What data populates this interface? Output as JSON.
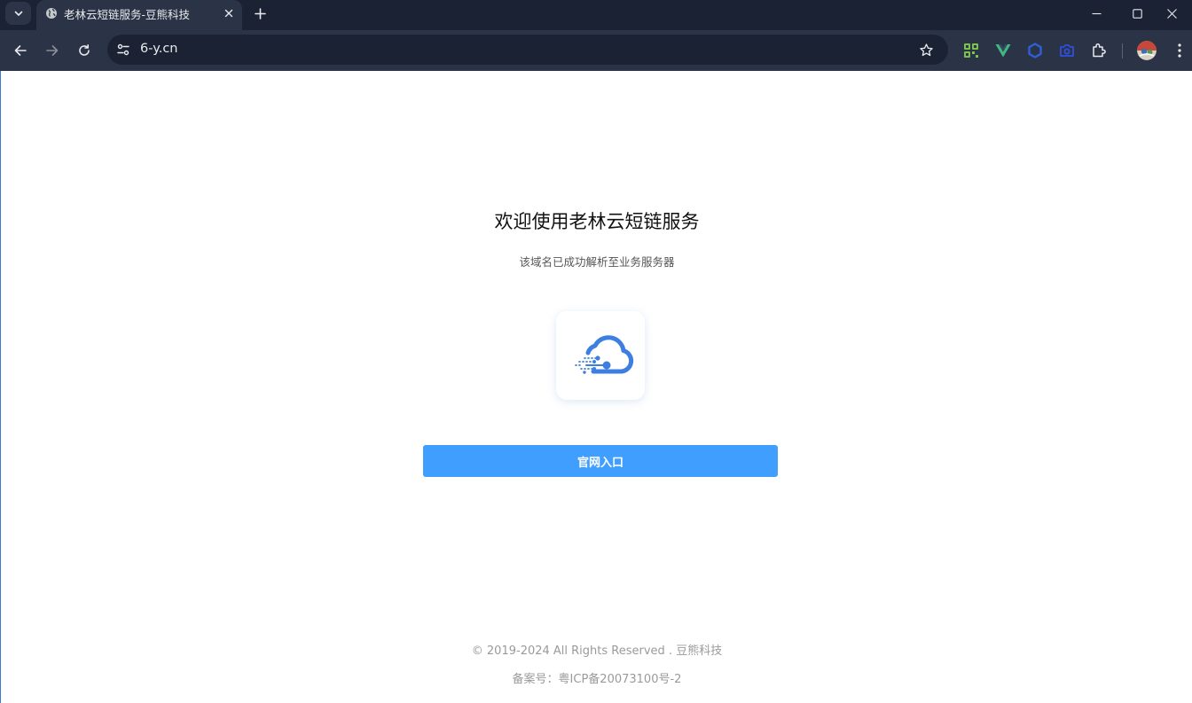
{
  "browser": {
    "tab_title": "老林云短链服务-豆熊科技",
    "url": "6-y.cn"
  },
  "page": {
    "heading": "欢迎使用老林云短链服务",
    "subheading": "该域名已成功解析至业务服务器",
    "button_label": "官网入口",
    "copyright": "© 2019-2024 All Rights Reserved . 豆熊科技",
    "icp": "备案号：粤ICP备20073100号-2"
  },
  "colors": {
    "primary_button": "#409eff",
    "logo_blue": "#3d7fe0"
  },
  "icons": {
    "tab_favicon": "globe-icon",
    "logo": "cloud-icon",
    "extensions": [
      "qr-code-icon",
      "vue-icon",
      "hexagon-icon",
      "camera-icon",
      "puzzle-icon"
    ]
  }
}
